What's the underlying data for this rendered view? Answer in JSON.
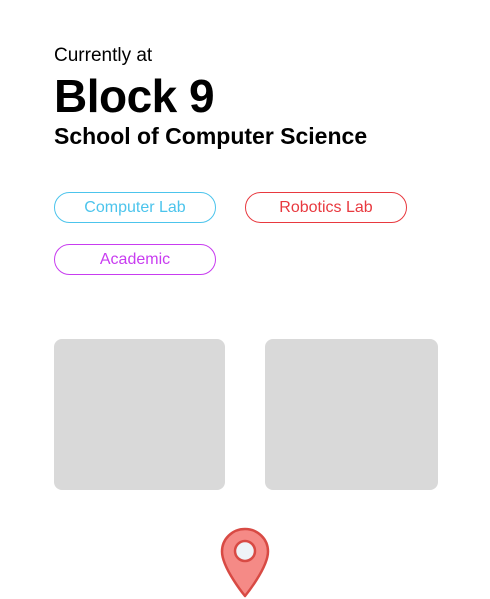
{
  "header": {
    "kicker": "Currently at",
    "title": "Block 9",
    "subtitle": "School of Computer Science"
  },
  "tags": [
    {
      "label": "Computer Lab",
      "color": "#4cc4ec"
    },
    {
      "label": "Robotics Lab",
      "color": "#e8393f"
    },
    {
      "label": "Academic",
      "color": "#c83cf0"
    }
  ],
  "tiles": {
    "color": "#d9d9d9"
  },
  "location_pin": {
    "icon": "map-pin-icon",
    "fill": "#f58a86",
    "stroke": "#d84a44",
    "center_fill": "#eef3f7"
  }
}
